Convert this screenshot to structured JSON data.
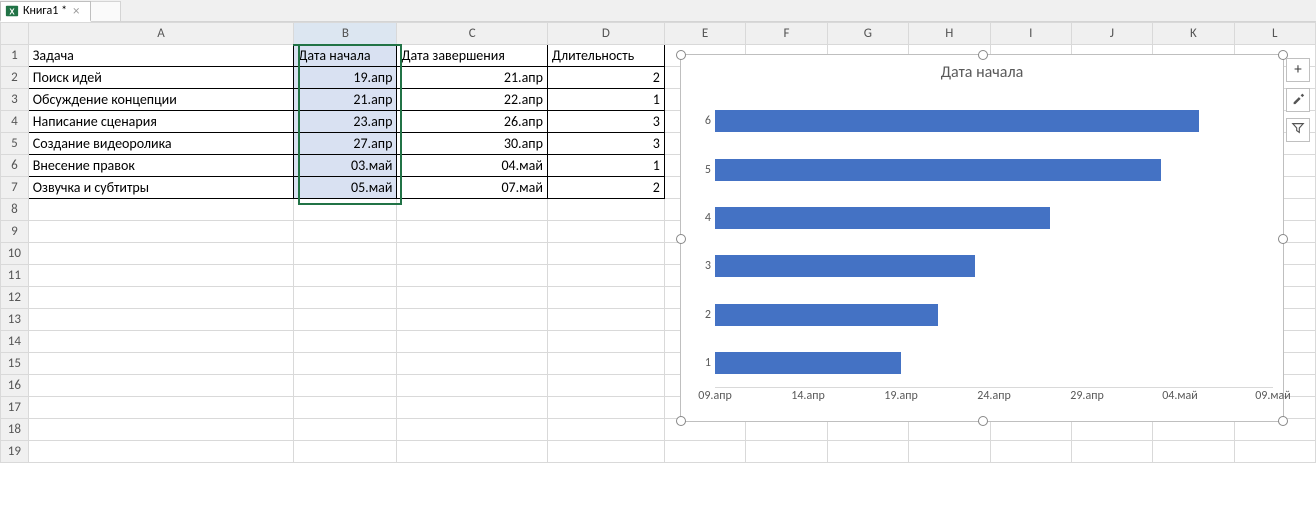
{
  "tab": {
    "name": "Книга1 *"
  },
  "columns": [
    "A",
    "B",
    "C",
    "D",
    "E",
    "F",
    "G",
    "H",
    "I",
    "J",
    "K",
    "L"
  ],
  "rows_visible": 19,
  "headers": {
    "A": "Задача",
    "B": "Дата начала",
    "C": "Дата завершения",
    "D": "Длительность"
  },
  "table": [
    {
      "task": "Поиск идей",
      "start": "19.апр",
      "end": "21.апр",
      "dur": "2"
    },
    {
      "task": "Обсуждение концепции",
      "start": "21.апр",
      "end": "22.апр",
      "dur": "1"
    },
    {
      "task": "Написание сценария",
      "start": "23.апр",
      "end": "26.апр",
      "dur": "3"
    },
    {
      "task": "Создание видеоролика",
      "start": "27.апр",
      "end": "30.апр",
      "dur": "3"
    },
    {
      "task": "Внесение правок",
      "start": "03.май",
      "end": "04.май",
      "dur": "1"
    },
    {
      "task": "Озвучка и субтитры",
      "start": "05.май",
      "end": "07.май",
      "dur": "2"
    }
  ],
  "chart_data": {
    "type": "bar",
    "orientation": "horizontal",
    "title": "Дата начала",
    "categories": [
      "1",
      "2",
      "3",
      "4",
      "5",
      "6"
    ],
    "x_ticks": [
      "09.апр",
      "14.апр",
      "19.апр",
      "24.апр",
      "29.апр",
      "04.май",
      "09.май"
    ],
    "x_min_serial": 44295,
    "x_max_serial": 44325,
    "series": [
      {
        "name": "Дата начала",
        "values_label": [
          "19.апр",
          "21.апр",
          "23.апр",
          "27.апр",
          "03.май",
          "05.май"
        ],
        "values_serial": [
          44305,
          44307,
          44309,
          44313,
          44319,
          44321
        ]
      }
    ]
  },
  "side_buttons": {
    "plus": "+",
    "brush": "brush",
    "filter": "filter"
  }
}
